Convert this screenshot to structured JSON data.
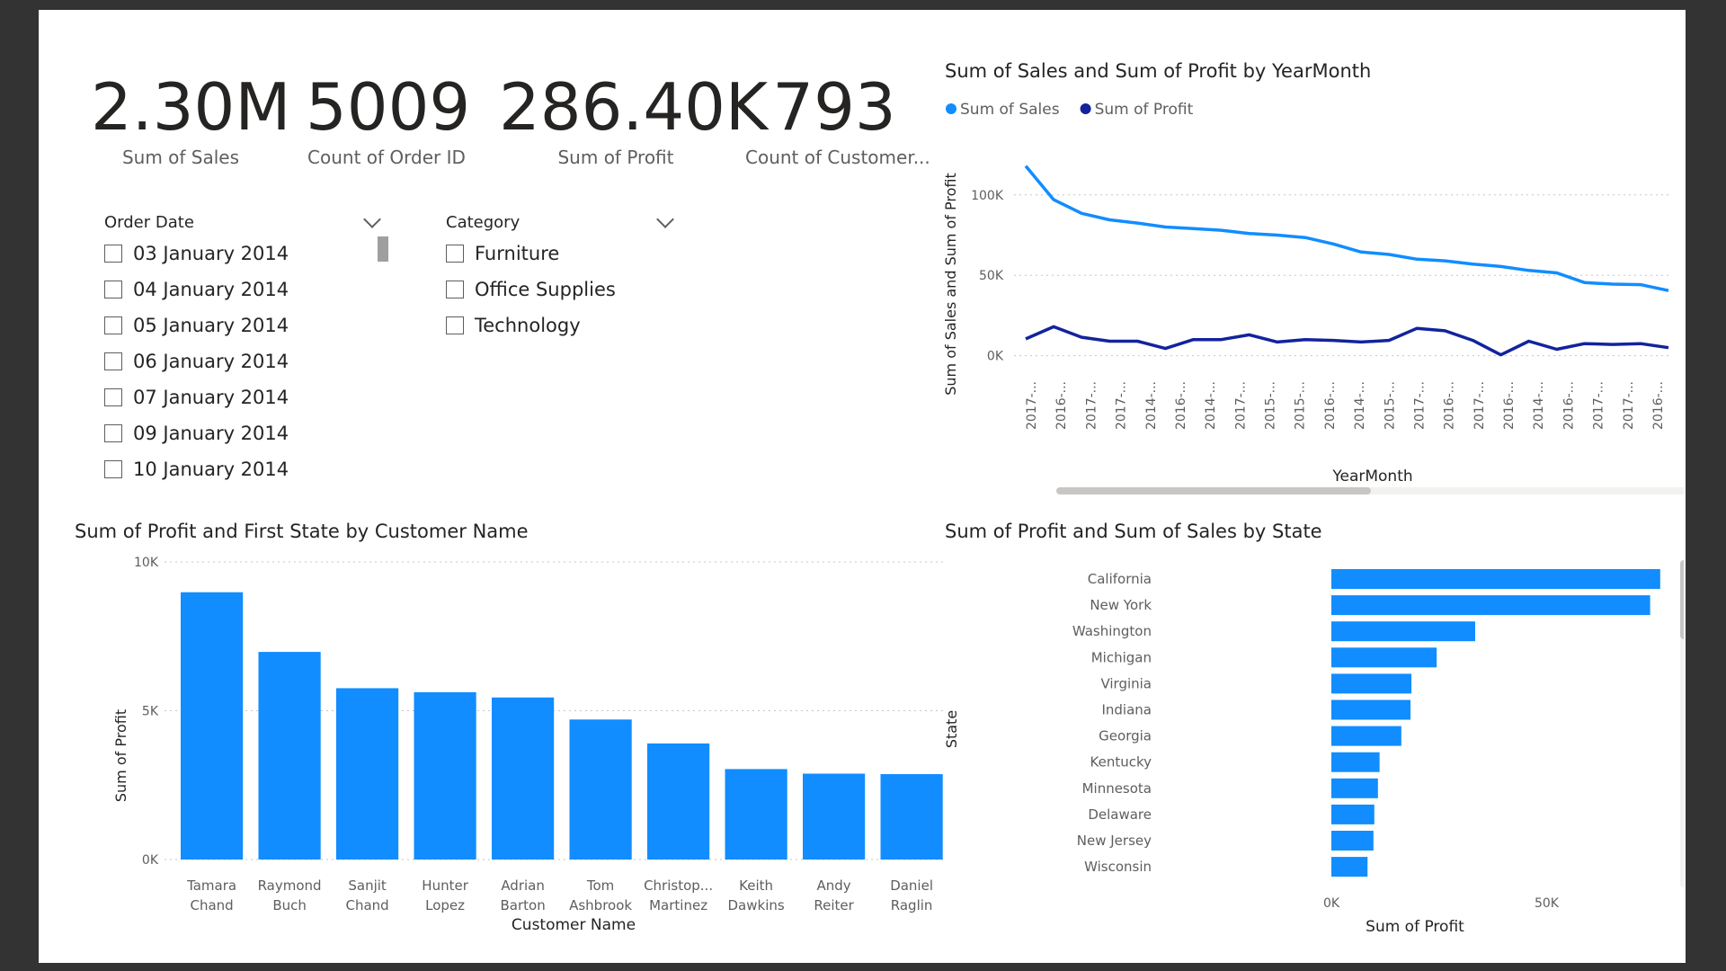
{
  "cards": [
    {
      "value": "2.30M",
      "label": "Sum of Sales"
    },
    {
      "value": "5009",
      "label": "Count of Order ID"
    },
    {
      "value": "286.40K",
      "label": "Sum of Profit"
    },
    {
      "value": "793",
      "label": "Count of Customer..."
    }
  ],
  "slicers": {
    "order_date": {
      "title": "Order Date",
      "items": [
        "03 January 2014",
        "04 January 2014",
        "05 January 2014",
        "06 January 2014",
        "07 January 2014",
        "09 January 2014",
        "10 January 2014"
      ]
    },
    "category": {
      "title": "Category",
      "items": [
        "Furniture",
        "Office Supplies",
        "Technology"
      ]
    }
  },
  "colors": {
    "sales": "#118dff",
    "profit": "#12239e",
    "bar": "#118dff",
    "grid": "#c8c6c4",
    "axis_text": "#605e5c"
  },
  "chart_data": [
    {
      "type": "line",
      "title": "Sum of Sales and Sum of Profit by YearMonth",
      "legend": "top-left",
      "xlabel": "YearMonth",
      "ylabel": "Sum of Sales and Sum of Profit",
      "ylim": [
        -3000,
        120000
      ],
      "yticks": [
        0,
        50000,
        100000
      ],
      "ytick_labels": [
        "0K",
        "50K",
        "100K"
      ],
      "x": [
        "2017-...",
        "2016-...",
        "2017-...",
        "2017-...",
        "2014-...",
        "2016-...",
        "2014-...",
        "2017-...",
        "2015-...",
        "2015-...",
        "2016-...",
        "2014-...",
        "2015-...",
        "2017-...",
        "2016-...",
        "2017-...",
        "2016-...",
        "2014-...",
        "2016-...",
        "2017-...",
        "2017-...",
        "2016-..."
      ],
      "series": [
        {
          "name": "Sum of Sales",
          "values": [
            118000,
            97000,
            88500,
            84500,
            82500,
            80000,
            79000,
            78000,
            76000,
            75000,
            73500,
            69500,
            64500,
            63000,
            60000,
            59000,
            57000,
            55500,
            53000,
            51500,
            45500,
            44500,
            44200,
            40500
          ]
        },
        {
          "name": "Sum of Profit",
          "values": [
            10500,
            18000,
            11500,
            9000,
            9000,
            4500,
            10000,
            10000,
            13000,
            8500,
            10000,
            9500,
            8500,
            9500,
            17000,
            15500,
            9500,
            500,
            9000,
            4000,
            7500,
            7000,
            7500,
            5000
          ]
        }
      ]
    },
    {
      "type": "bar",
      "title": "Sum of Profit and First State by Customer Name",
      "xlabel": "Customer Name",
      "ylabel": "Sum of Profit",
      "ylim": [
        0,
        10000
      ],
      "yticks": [
        0,
        5000,
        10000
      ],
      "ytick_labels": [
        "0K",
        "5K",
        "10K"
      ],
      "categories": [
        [
          "Tamara",
          "Chand"
        ],
        [
          "Raymond",
          "Buch"
        ],
        [
          "Sanjit",
          "Chand"
        ],
        [
          "Hunter",
          "Lopez"
        ],
        [
          "Adrian",
          "Barton"
        ],
        [
          "Tom",
          "Ashbrook"
        ],
        [
          "Christop...",
          "Martinez"
        ],
        [
          "Keith",
          "Dawkins"
        ],
        [
          "Andy",
          "Reiter"
        ],
        [
          "Daniel",
          "Raglin"
        ]
      ],
      "values": [
        8981,
        6976,
        5757,
        5622,
        5445,
        4704,
        3900,
        3039,
        2885,
        2869
      ]
    },
    {
      "type": "bar",
      "orientation": "horizontal",
      "title": "Sum of Profit and Sum of Sales by State",
      "xlabel": "Sum of Profit",
      "ylabel": "State",
      "xlim": [
        0,
        76000
      ],
      "xticks": [
        0,
        50000
      ],
      "xtick_labels": [
        "0K",
        "50K"
      ],
      "categories": [
        "California",
        "New York",
        "Washington",
        "Michigan",
        "Virginia",
        "Indiana",
        "Georgia",
        "Kentucky",
        "Minnesota",
        "Delaware",
        "New Jersey",
        "Wisconsin"
      ],
      "values": [
        76381,
        74039,
        33403,
        24463,
        18598,
        18383,
        16250,
        11200,
        10823,
        9977,
        9773,
        8402
      ]
    }
  ]
}
